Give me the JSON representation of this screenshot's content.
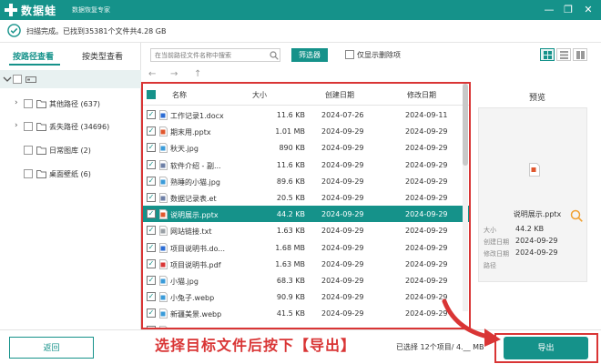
{
  "titlebar": {
    "app_name": "数据蛙",
    "app_subtitle": "数据恢复专家"
  },
  "window_controls": {
    "min": "—",
    "max": "❐",
    "close": "✕"
  },
  "scan": {
    "status_text": "扫描完成。已找到35381个文件共4.28 GB"
  },
  "sidebar": {
    "tabs": [
      {
        "label": "按路径查看"
      },
      {
        "label": "按类型查看"
      }
    ],
    "root_label": "",
    "items": [
      {
        "label": "其他路径 (637)",
        "expandable": true
      },
      {
        "label": "丢失路径 (34696)",
        "expandable": true
      },
      {
        "label": "日常图库 (2)",
        "expandable": false
      },
      {
        "label": "桌面壁纸 (6)",
        "expandable": false
      }
    ]
  },
  "toolbar": {
    "search_placeholder": "在当前路径文件名称中搜索",
    "filter_label": "筛选器",
    "only_deleted_label": "仅显示删除项"
  },
  "nav": {
    "back": "←",
    "forward": "→",
    "up": "↑"
  },
  "table": {
    "columns": {
      "name": "名称",
      "size": "大小",
      "created": "创建日期",
      "modified": "修改日期"
    },
    "rows": [
      {
        "name": "工作记录1.docx",
        "size": "11.6 KB",
        "created": "2024-07-26",
        "modified": "2024-09-11",
        "type": "docx",
        "checked": true
      },
      {
        "name": "期末用.pptx",
        "size": "1.01 MB",
        "created": "2024-09-29",
        "modified": "2024-09-29",
        "type": "pptx",
        "checked": true
      },
      {
        "name": "秋天.jpg",
        "size": "890 KB",
        "created": "2024-09-29",
        "modified": "2024-09-29",
        "type": "jpg",
        "checked": true
      },
      {
        "name": "软件介绍 - 副...",
        "size": "11.6 KB",
        "created": "2024-09-29",
        "modified": "2024-09-29",
        "type": "doc",
        "checked": true
      },
      {
        "name": "熟睡的小猫.jpg",
        "size": "89.6 KB",
        "created": "2024-09-29",
        "modified": "2024-09-29",
        "type": "jpg",
        "checked": true
      },
      {
        "name": "数据记录表.et",
        "size": "20.5 KB",
        "created": "2024-09-29",
        "modified": "2024-09-29",
        "type": "doc",
        "checked": true
      },
      {
        "name": "说明展示.pptx",
        "size": "44.2 KB",
        "created": "2024-09-29",
        "modified": "2024-09-29",
        "type": "pptx",
        "checked": true,
        "selected": true
      },
      {
        "name": "网站链接.txt",
        "size": "1.63 KB",
        "created": "2024-09-29",
        "modified": "2024-09-29",
        "type": "txt",
        "checked": true
      },
      {
        "name": "项目说明书.do...",
        "size": "1.68 MB",
        "created": "2024-09-29",
        "modified": "2024-09-29",
        "type": "docx",
        "checked": true
      },
      {
        "name": "项目说明书.pdf",
        "size": "1.63 MB",
        "created": "2024-09-29",
        "modified": "2024-09-29",
        "type": "pdf",
        "checked": true
      },
      {
        "name": "小猫.jpg",
        "size": "68.3 KB",
        "created": "2024-09-29",
        "modified": "2024-09-29",
        "type": "jpg",
        "checked": true
      },
      {
        "name": "小兔子.webp",
        "size": "90.9 KB",
        "created": "2024-09-29",
        "modified": "2024-09-29",
        "type": "jpg",
        "checked": true
      },
      {
        "name": "新疆美景.webp",
        "size": "41.5 KB",
        "created": "2024-09-29",
        "modified": "2024-09-29",
        "type": "jpg",
        "checked": true
      },
      {
        "name": "星空.webp",
        "size": "_6 KB",
        "created": "2024-09-29",
        "modified": "2024-09-29",
        "type": "jpg",
        "checked": true
      }
    ]
  },
  "preview": {
    "title": "预览",
    "file_name": "说明展示.pptx",
    "labels": {
      "size": "大小",
      "created": "创建日期",
      "modified": "修改日期",
      "path": "路径"
    },
    "values": {
      "size": "44.2 KB",
      "created": "2024-09-29",
      "modified": "2024-09-29",
      "path": ""
    }
  },
  "footer": {
    "back_label": "返回",
    "caption": "选择目标文件后按下【导出】",
    "status": "已选择 12个项目/ 4.__ MB",
    "export_label": "导出"
  },
  "colors": {
    "accent": "#15928a",
    "highlight_red": "#d93535"
  }
}
